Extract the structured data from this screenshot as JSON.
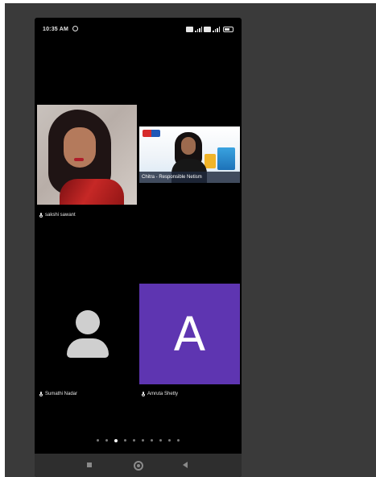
{
  "status_bar": {
    "time": "10:35 AM",
    "alarm_icon": "alarm-clock-icon",
    "indicators": [
      "sim-icon",
      "signal-icon",
      "wifi-signal-icon",
      "battery-icon"
    ]
  },
  "meeting": {
    "participants": [
      {
        "name": "sakshi sawant",
        "tile": "video",
        "mic_icon": "microphone-icon"
      },
      {
        "name": "Chitra - Responsible Netism",
        "tile": "screen-share"
      },
      {
        "name": "Sumathi Nadar",
        "tile": "avatar-placeholder",
        "avatar_icon": "person-icon",
        "mic_icon": "microphone-icon"
      },
      {
        "name": "Amruta Shetty",
        "tile": "avatar-initial",
        "initial": "A",
        "mic_icon": "microphone-icon",
        "avatar_color": "#5e35b1"
      }
    ],
    "pager": {
      "total_pages": 10,
      "current_page": 3
    }
  },
  "nav_bar": {
    "buttons": [
      "recent-apps-icon",
      "home-icon",
      "back-icon"
    ]
  },
  "colors": {
    "backdrop": "#3a3a3a",
    "phone_background": "#000000",
    "nav_bar": "#2e2e2e"
  }
}
